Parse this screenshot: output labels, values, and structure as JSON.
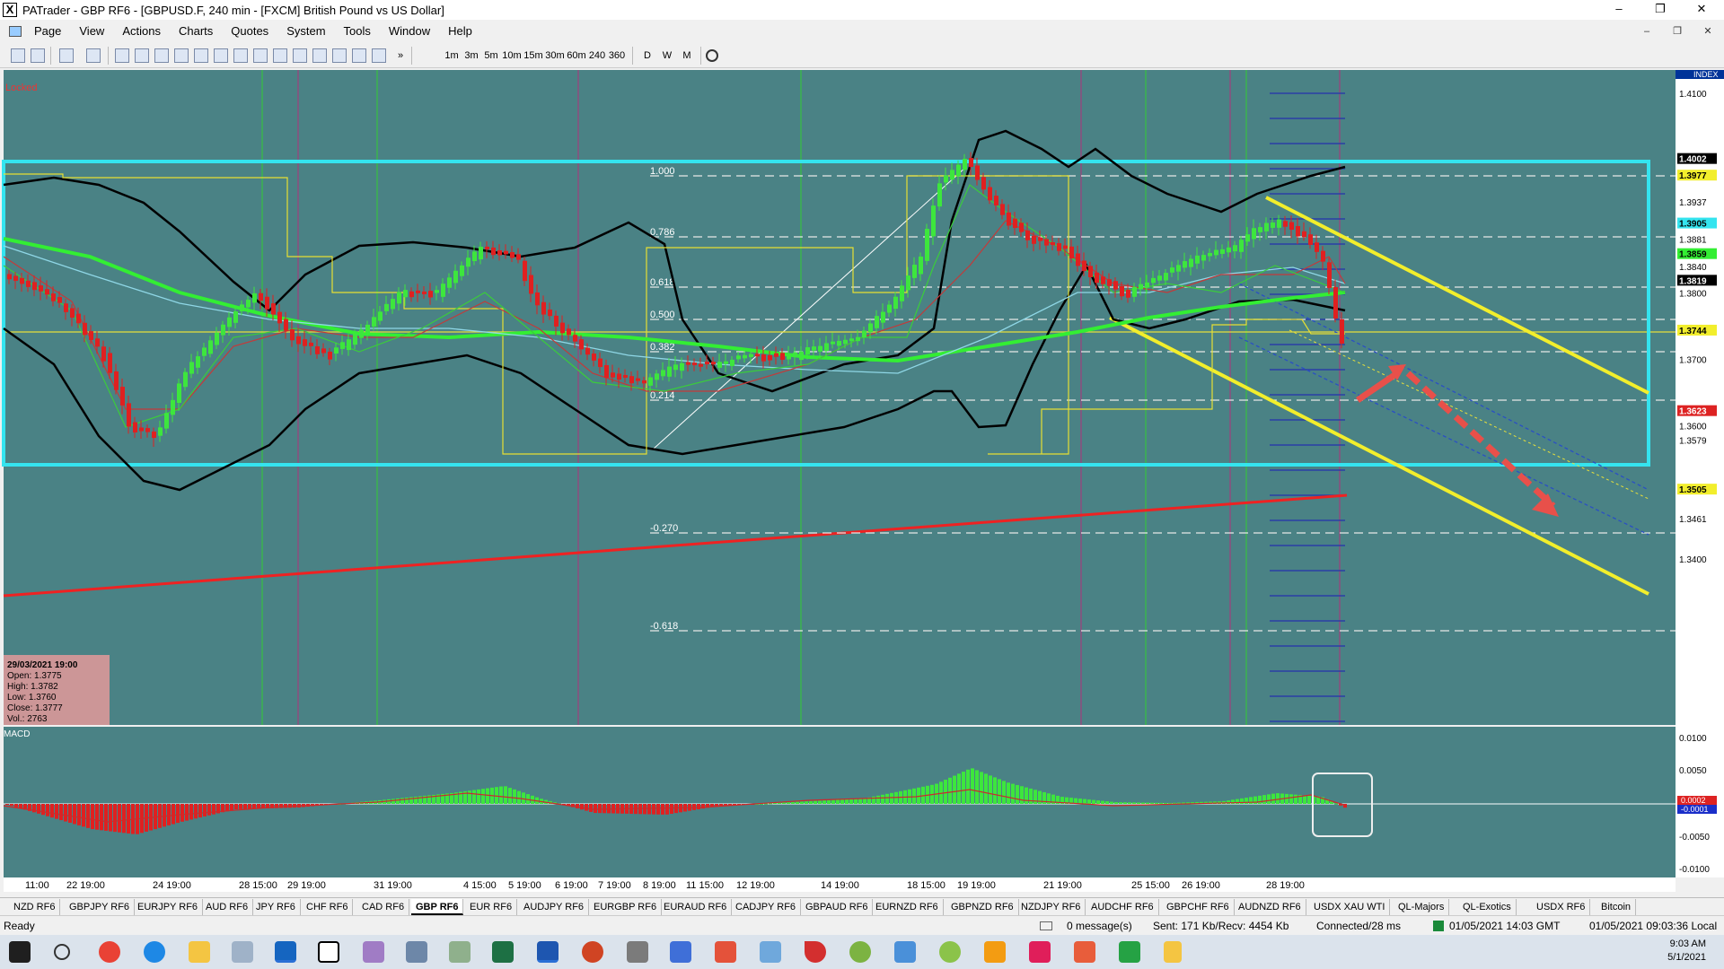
{
  "window": {
    "title": "PATrader - GBP RF6 - [GBPUSD.F, 240 min - [FXCM] British Pound vs US Dollar]",
    "icon": "x-app-icon",
    "minimize": "–",
    "maximize": "❐",
    "close": "✕"
  },
  "menu": {
    "items": [
      "Page",
      "View",
      "Actions",
      "Charts",
      "Quotes",
      "System",
      "Tools",
      "Window",
      "Help"
    ],
    "mdi_controls": [
      "–",
      "❐",
      "✕"
    ]
  },
  "toolbar": {
    "timeframes": [
      "1m",
      "3m",
      "5m",
      "10m",
      "15m",
      "30m",
      "60m",
      "240",
      "360"
    ],
    "periods": [
      "D",
      "W",
      "M"
    ],
    "overflow": "»"
  },
  "chart": {
    "locked": "Locked",
    "index_label": "INDEX",
    "colors": {
      "background": "#4a8285",
      "box": "#34e4ef",
      "channel": "#f2ee2c",
      "long_trend": "#ee2222",
      "ma_fast": "#33ee33",
      "bull": "#3de63d",
      "bear": "#e02020",
      "arrow": "#e8504a"
    },
    "price_axis": [
      "1.4100",
      "1.4002",
      "1.3977",
      "1.3937",
      "1.3905",
      "1.3881",
      "1.3859",
      "1.3840",
      "1.3819",
      "1.3800",
      "1.3744",
      "1.3700",
      "1.3623",
      "1.3600",
      "1.3579",
      "1.3505",
      "1.3461",
      "1.3400"
    ],
    "fib_levels": [
      "1.000",
      "0.786",
      "0.618",
      "0.500",
      "0.382",
      "0.214",
      "-0.270",
      "-0.618"
    ],
    "date_axis": [
      "11:00",
      "22 19:00",
      "24 19:00",
      "28 15:00",
      "29 19:00",
      "31 19:00",
      "4 15:00",
      "5 19:00",
      "6 19:00",
      "7 19:00",
      "8 19:00",
      "11 15:00",
      "12 19:00",
      "14 19:00",
      "18 15:00",
      "19 19:00",
      "21 19:00",
      "25 15:00",
      "26 19:00",
      "28 19:00"
    ],
    "info_box": {
      "date": "29/03/2021 19:00",
      "open": "Open: 1.3775",
      "high": "High: 1.3782",
      "low": "Low: 1.3760",
      "close": "Close: 1.3777",
      "vol": "Vol.: 2763"
    }
  },
  "macd": {
    "label": "MACD",
    "axis": [
      "0.0100",
      "0.0050",
      "0.0000",
      "-0.0050",
      "-0.0100"
    ],
    "badges": [
      "0.0002",
      "-0.0001"
    ]
  },
  "tabs": [
    "NZD RF6",
    "GBPJPY RF6",
    "EURJPY RF6",
    "AUD RF6",
    "JPY RF6",
    "CHF RF6",
    "CAD RF6",
    "GBP RF6",
    "EUR RF6",
    "AUDJPY RF6",
    "EURGBP RF6",
    "EURAUD RF6",
    "CADJPY RF6",
    "GBPAUD RF6",
    "EURNZD RF6",
    "GBPNZD RF6",
    "NZDJPY RF6",
    "AUDCHF RF6",
    "GBPCHF RF6",
    "AUDNZD RF6",
    "USDX XAU WTI",
    "QL-Majors",
    "QL-Exotics",
    "USDX RF6",
    "Bitcoin"
  ],
  "active_tab": "GBP RF6",
  "status": {
    "ready": "Ready",
    "messages": "0 message(s)",
    "traffic": "Sent: 171 Kb/Recv: 4454 Kb",
    "connected": "Connected/28 ms",
    "server_time": "01/05/2021 14:03 GMT",
    "local_time": "01/05/2021 09:03:36 Local"
  },
  "taskbar": {
    "time": "9:03 AM",
    "date": "5/1/2021"
  }
}
